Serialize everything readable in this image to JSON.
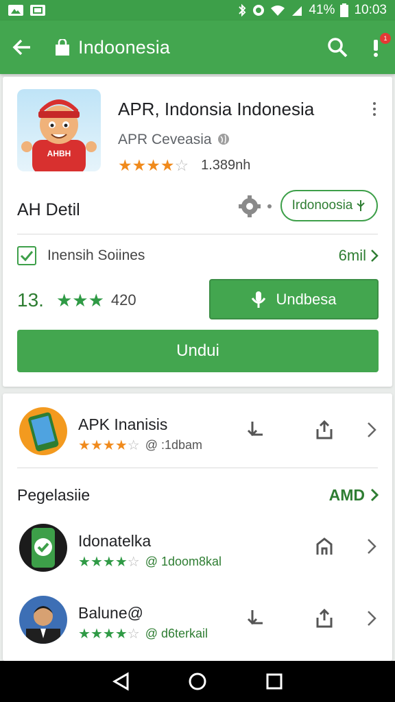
{
  "status_bar": {
    "battery": "41%",
    "time": "10:03"
  },
  "app_bar": {
    "title": "Indoonesia",
    "notification_count": "1"
  },
  "app_detail": {
    "name": "APR, Indonsia Indonesia",
    "developer": "APR Ceveasia",
    "rating_count": "1.389nh",
    "icon_label": "AHBH",
    "detail_label": "AH Detil",
    "chip_label": "Irdonoosia",
    "checkbox_label": "Inensih Soiines",
    "size_link": "6mil",
    "rating_value": "13.",
    "rating_sub": "420",
    "secondary_button": "Undbesa",
    "primary_button": "Undui"
  },
  "colors": {
    "brand_green": "#43a64f",
    "star_orange": "#f08a1c",
    "star_green": "#2f9a45"
  },
  "list": {
    "first_item": {
      "title": "APK Inanisis",
      "meta": "@ :1dbam",
      "stars": 4
    },
    "section_title": "Pegelasiie",
    "section_more": "AMD",
    "items": [
      {
        "title": "Idonatelka",
        "meta": "@ 1doom8kal",
        "stars": 4
      },
      {
        "title": "Balune@",
        "meta": "@ d6terkail",
        "stars": 4
      }
    ]
  }
}
